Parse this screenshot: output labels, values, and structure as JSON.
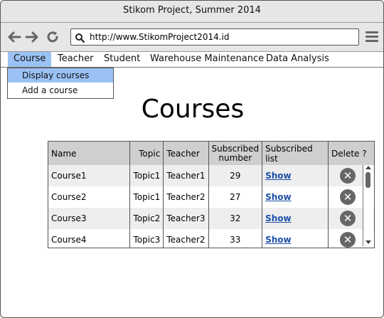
{
  "window": {
    "title": "Stikom Project, Summer 2014"
  },
  "toolbar": {
    "back_icon": "arrow-left-icon",
    "forward_icon": "arrow-right-icon",
    "reload_icon": "reload-icon",
    "url": "http://www.StikomProject2014.id",
    "menu_icon": "hamburger-menu-icon"
  },
  "menu": {
    "items": [
      {
        "label": "Course",
        "active": true
      },
      {
        "label": "Teacher"
      },
      {
        "label": "Student"
      },
      {
        "label": "Warehouse Maintenance"
      },
      {
        "label": "Data Analysis"
      }
    ],
    "dropdown": [
      {
        "label": "Display courses",
        "selected": true
      },
      {
        "label": "Add a course"
      }
    ]
  },
  "page": {
    "title": "Courses"
  },
  "table": {
    "headers": {
      "name": "Name",
      "topic": "Topic",
      "teacher": "Teacher",
      "subscribed_number": "Subscribed number",
      "subscribed_list": "Subscribed list",
      "delete": "Delete ?"
    },
    "rows": [
      {
        "name": "Course1",
        "topic": "Topic1",
        "teacher": "Teacher1",
        "subscribed_number": "29",
        "list_link": "Show"
      },
      {
        "name": "Course2",
        "topic": "Topic1",
        "teacher": "Teacher2",
        "subscribed_number": "27",
        "list_link": "Show"
      },
      {
        "name": "Course3",
        "topic": "Topic2",
        "teacher": "Teacher3",
        "subscribed_number": "32",
        "list_link": "Show"
      },
      {
        "name": "Course4",
        "topic": "Topic3",
        "teacher": "Teacher2",
        "subscribed_number": "33",
        "list_link": "Show"
      }
    ],
    "delete_icon": "delete-circle-x-icon"
  },
  "colors": {
    "selection": "#9bc2f4",
    "link": "#1c4fa8",
    "header_bg": "#cfcfcf",
    "zebra": "#eeeeee"
  }
}
